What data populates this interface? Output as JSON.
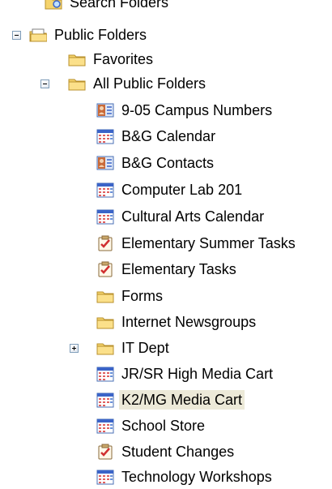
{
  "tree": {
    "top_partial": {
      "label": "Search Folders",
      "icon": "search-folder-icon"
    },
    "public_folders": {
      "label": "Public Folders",
      "icon": "public-folders-icon",
      "expanded": true
    },
    "favorites": {
      "label": "Favorites",
      "icon": "folder-icon"
    },
    "all_public_folders": {
      "label": "All Public Folders",
      "icon": "folder-icon",
      "expanded": true
    },
    "items": [
      {
        "label": "9-05 Campus Numbers",
        "icon": "contacts-icon"
      },
      {
        "label": "B&G Calendar",
        "icon": "calendar-icon"
      },
      {
        "label": "B&G Contacts",
        "icon": "contacts-icon"
      },
      {
        "label": "Computer Lab 201",
        "icon": "calendar-icon"
      },
      {
        "label": "Cultural Arts Calendar",
        "icon": "calendar-icon"
      },
      {
        "label": "Elementary Summer Tasks",
        "icon": "tasks-icon"
      },
      {
        "label": "Elementary Tasks",
        "icon": "tasks-icon"
      },
      {
        "label": "Forms",
        "icon": "folder-icon"
      },
      {
        "label": "Internet Newsgroups",
        "icon": "folder-icon"
      },
      {
        "label": "IT Dept",
        "icon": "folder-icon",
        "collapsed": true
      },
      {
        "label": "JR/SR High Media Cart",
        "icon": "calendar-icon"
      },
      {
        "label": "K2/MG Media Cart",
        "icon": "calendar-icon",
        "selected": true
      },
      {
        "label": "School Store",
        "icon": "calendar-icon"
      },
      {
        "label": "Student Changes",
        "icon": "tasks-icon"
      },
      {
        "label": "Technology Workshops",
        "icon": "calendar-icon"
      }
    ]
  }
}
